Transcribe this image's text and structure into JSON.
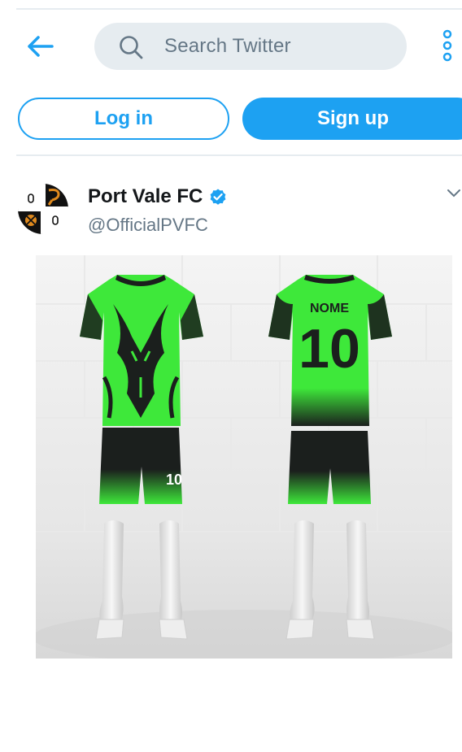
{
  "nav": {
    "back_icon": "arrow-left-icon",
    "search_placeholder": "Search Twitter",
    "search_icon": "search-icon",
    "more_icon": "more-vertical-icon"
  },
  "auth": {
    "login_label": "Log in",
    "signup_label": "Sign up"
  },
  "tweet": {
    "display_name": "Port Vale FC",
    "handle": "@OfficialPVFC",
    "verified": true,
    "verified_icon": "verified-badge-icon",
    "menu_icon": "chevron-down-icon",
    "media": {
      "jersey_back_name": "NOME",
      "jersey_back_number": "10",
      "shorts_number": "10"
    }
  },
  "colors": {
    "accent": "#1da1f2",
    "text_primary": "#14171a",
    "text_secondary": "#657786",
    "divider": "#e6ecf0",
    "search_bg": "#e6ecf0",
    "kit_green": "#3ee83a",
    "kit_black": "#1b1f1d"
  }
}
